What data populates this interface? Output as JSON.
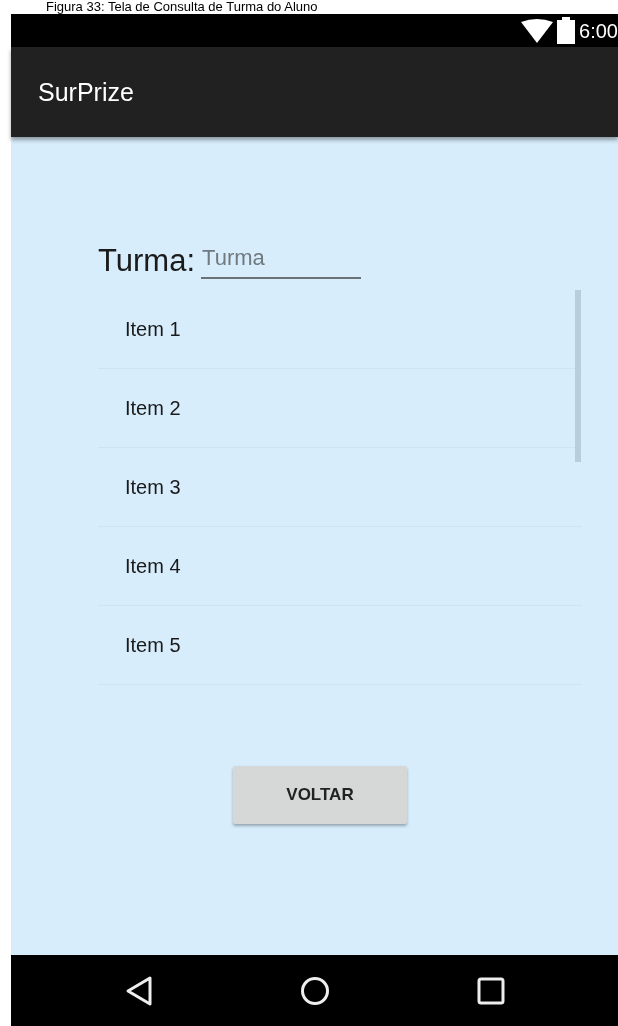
{
  "caption": "Figura 33: Tela de Consulta de Turma do Aluno",
  "status_bar": {
    "time": "6:00"
  },
  "app_bar": {
    "title": "SurPrize"
  },
  "form": {
    "label": "Turma:",
    "field": {
      "placeholder": "Turma"
    }
  },
  "list": {
    "items": [
      {
        "label": "Item 1"
      },
      {
        "label": "Item 2"
      },
      {
        "label": "Item 3"
      },
      {
        "label": "Item 4"
      },
      {
        "label": "Item 5"
      }
    ]
  },
  "button": {
    "label": "VOLTAR"
  }
}
